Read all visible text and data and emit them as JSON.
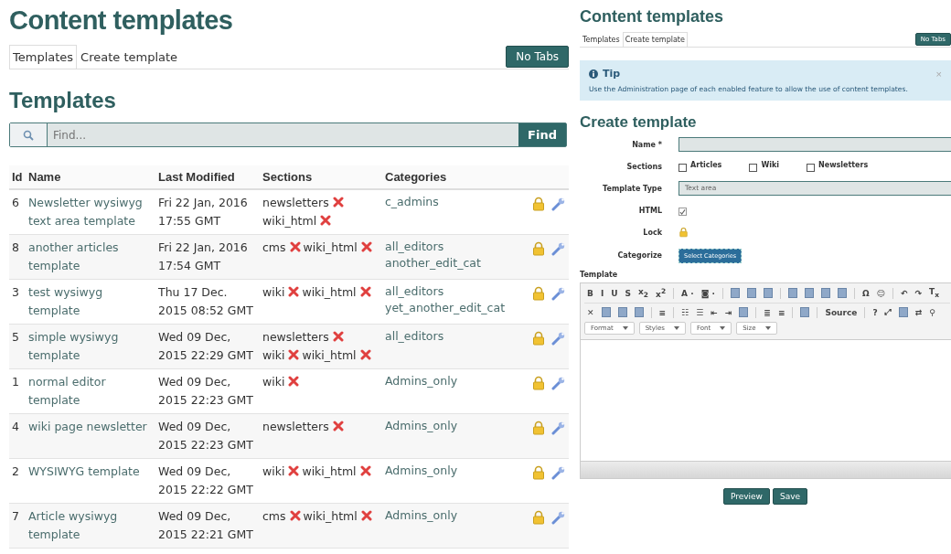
{
  "left": {
    "title": "Content templates",
    "tabs": [
      {
        "label": "Templates",
        "selected": true
      },
      {
        "label": "Create template",
        "selected": false
      }
    ],
    "no_tabs_button": "No Tabs",
    "heading": "Templates",
    "search": {
      "placeholder": "Find...",
      "button": "Find"
    },
    "table": {
      "columns": [
        "Id",
        "Name",
        "Last Modified",
        "Sections",
        "Categories"
      ],
      "rows": [
        {
          "id": "6",
          "name": "Newsletter wysiwyg text area template",
          "modified": "Fri 22 Jan, 2016 17:55 GMT",
          "sections": [
            "newsletters",
            "wiki_html"
          ],
          "categories": [
            "c_admins"
          ]
        },
        {
          "id": "8",
          "name": "another articles template",
          "modified": "Fri 22 Jan, 2016 17:54 GMT",
          "sections": [
            "cms",
            "wiki_html"
          ],
          "categories": [
            "all_editors",
            "another_edit_cat"
          ]
        },
        {
          "id": "3",
          "name": "test wysiwyg template",
          "modified": "Thu 17 Dec. 2015 08:52 GMT",
          "sections": [
            "wiki",
            "wiki_html"
          ],
          "categories": [
            "all_editors",
            "yet_another_edit_cat"
          ]
        },
        {
          "id": "5",
          "name": "simple wysiwyg template",
          "modified": "Wed 09 Dec, 2015 22:29 GMT",
          "sections": [
            "newsletters",
            "wiki",
            "wiki_html"
          ],
          "categories": [
            "all_editors"
          ]
        },
        {
          "id": "1",
          "name": "normal editor template",
          "modified": "Wed 09 Dec, 2015 22:23 GMT",
          "sections": [
            "wiki"
          ],
          "categories": [
            "Admins_only"
          ]
        },
        {
          "id": "4",
          "name": "wiki page newsletter",
          "modified": "Wed 09 Dec, 2015 22:23 GMT",
          "sections": [
            "newsletters"
          ],
          "categories": [
            "Admins_only"
          ]
        },
        {
          "id": "2",
          "name": "WYSIWYG template",
          "modified": "Wed 09 Dec, 2015 22:22 GMT",
          "sections": [
            "wiki",
            "wiki_html"
          ],
          "categories": [
            "Admins_only"
          ]
        },
        {
          "id": "7",
          "name": "Article wysiwyg template",
          "modified": "Wed 09 Dec, 2015 22:21 GMT",
          "sections": [
            "cms",
            "wiki_html"
          ],
          "categories": [
            "Admins_only"
          ]
        }
      ]
    }
  },
  "right": {
    "title": "Content templates",
    "tabs": [
      {
        "label": "Templates",
        "selected": false
      },
      {
        "label": "Create template",
        "selected": true
      }
    ],
    "no_tabs_button": "No Tabs",
    "tip": {
      "title": "Tip",
      "text": "Use the Administration page of each enabled feature to allow the use of content templates.",
      "close": "×"
    },
    "heading": "Create template",
    "form": {
      "name_label": "Name *",
      "sections_label": "Sections",
      "sections": [
        {
          "label": "Articles",
          "checked": false
        },
        {
          "label": "Wiki",
          "checked": false
        },
        {
          "label": "Newsletters",
          "checked": false
        }
      ],
      "type_label": "Template Type",
      "type_value": "Text area",
      "html_label": "HTML",
      "html_checked": true,
      "lock_label": "Lock",
      "categorize_label": "Categorize",
      "categorize_button": "Select Categories"
    },
    "template_label": "Template",
    "toolbar_1": [
      {
        "kind": "glyph",
        "text": "B"
      },
      {
        "kind": "glyph",
        "text": "I"
      },
      {
        "kind": "glyph",
        "text": "U"
      },
      {
        "kind": "glyph",
        "text": "S"
      },
      {
        "kind": "glyph",
        "text": "x$_{2}$"
      },
      {
        "kind": "glyph",
        "text": "x$^{2}$"
      },
      {
        "kind": "sep"
      },
      {
        "kind": "glyph",
        "text": "A ·"
      },
      {
        "kind": "glyph",
        "text": "◙ ·"
      },
      {
        "kind": "sep"
      },
      {
        "kind": "icon"
      },
      {
        "kind": "icon"
      },
      {
        "kind": "icon"
      },
      {
        "kind": "sep"
      },
      {
        "kind": "icon"
      },
      {
        "kind": "icon"
      },
      {
        "kind": "icon"
      },
      {
        "kind": "icon"
      },
      {
        "kind": "sep"
      },
      {
        "kind": "glyph",
        "text": "Ω"
      },
      {
        "kind": "glyph",
        "text": "☺"
      },
      {
        "kind": "sep"
      },
      {
        "kind": "glyph",
        "text": "↶"
      },
      {
        "kind": "glyph",
        "text": "↷"
      },
      {
        "kind": "glyph",
        "text": "T$_{x}$"
      }
    ],
    "toolbar_2": [
      {
        "kind": "glyph",
        "text": "✕"
      },
      {
        "kind": "icon"
      },
      {
        "kind": "icon"
      },
      {
        "kind": "icon"
      },
      {
        "kind": "sep"
      },
      {
        "kind": "glyph",
        "text": "≡"
      },
      {
        "kind": "sep"
      },
      {
        "kind": "glyph",
        "text": "☷"
      },
      {
        "kind": "glyph",
        "text": "☰"
      },
      {
        "kind": "glyph",
        "text": "⇤"
      },
      {
        "kind": "glyph",
        "text": "⇥"
      },
      {
        "kind": "icon"
      },
      {
        "kind": "sep"
      },
      {
        "kind": "glyph",
        "text": "≣"
      },
      {
        "kind": "glyph",
        "text": "≡"
      },
      {
        "kind": "sep"
      },
      {
        "kind": "icon"
      },
      {
        "kind": "sep"
      },
      {
        "kind": "glyph",
        "text": "Source"
      },
      {
        "kind": "sep"
      },
      {
        "kind": "glyph",
        "text": "?"
      },
      {
        "kind": "glyph",
        "text": "⤢"
      },
      {
        "kind": "icon"
      },
      {
        "kind": "glyph",
        "text": "⇄"
      },
      {
        "kind": "glyph",
        "text": "⚲"
      }
    ],
    "dropdowns": [
      "Format",
      "Styles",
      "Font",
      "Size"
    ],
    "buttons": [
      "Preview",
      "Save"
    ]
  }
}
